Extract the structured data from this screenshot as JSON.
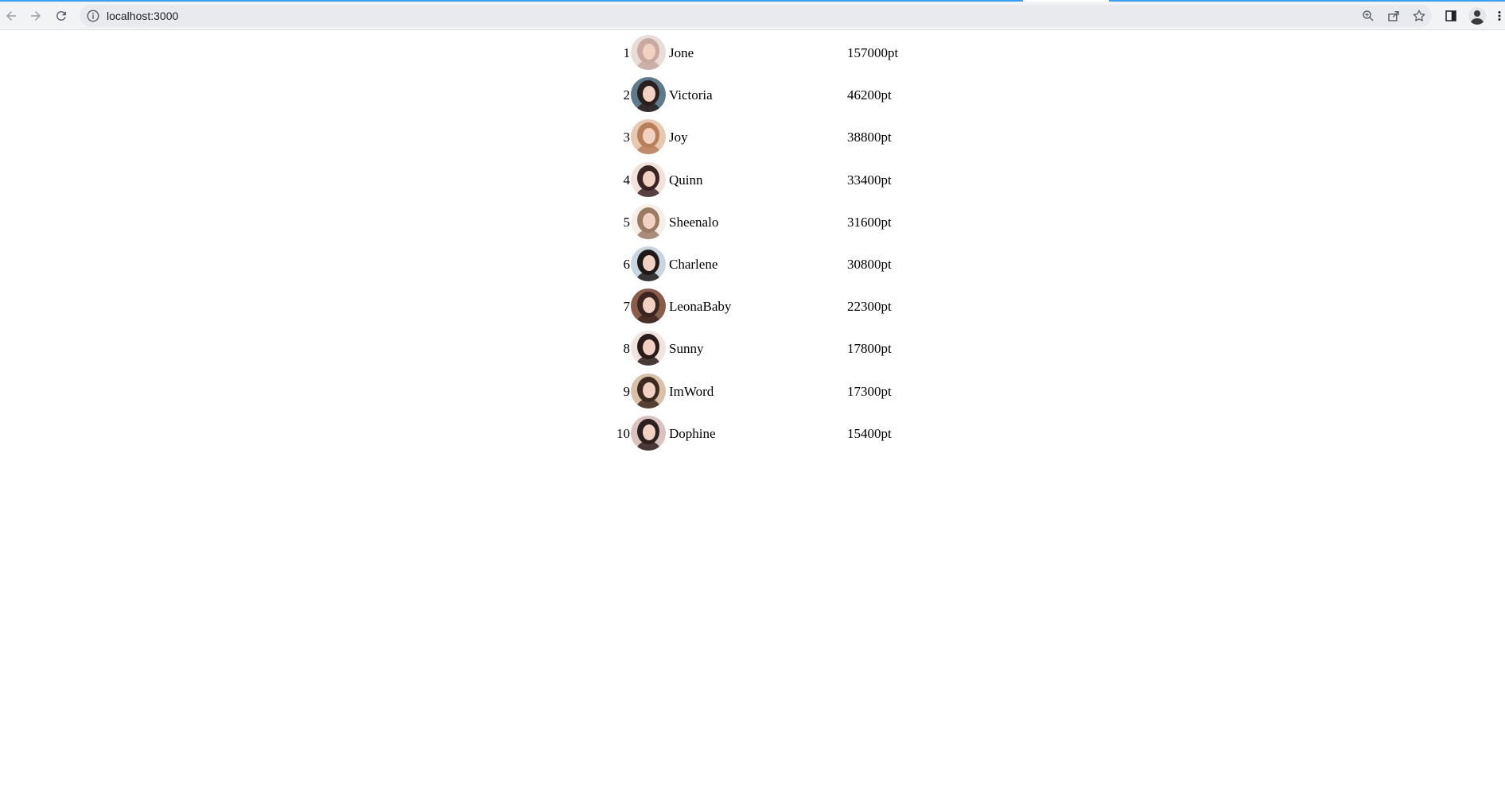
{
  "browser": {
    "url": "localhost:3000",
    "icons": {
      "back": "arrow-left-icon",
      "forward": "arrow-right-icon",
      "reload": "reload-icon",
      "info": "info-icon",
      "zoom": "zoom-icon",
      "share": "share-icon",
      "bookmark": "star-icon",
      "side_panel": "side-panel-icon",
      "profile": "profile-avatar",
      "menu": "kebab-menu-icon"
    },
    "accent": "#3aa0f3"
  },
  "ranking": [
    {
      "rank": "1",
      "name": "Jone",
      "score": "157000pt",
      "avatar_color": "#e8dcd8",
      "hair_color": "#c8a9a0"
    },
    {
      "rank": "2",
      "name": "Victoria",
      "score": "46200pt",
      "avatar_color": "#5c7a8c",
      "hair_color": "#2a1f1c"
    },
    {
      "rank": "3",
      "name": "Joy",
      "score": "38800pt",
      "avatar_color": "#e7c9b2",
      "hair_color": "#b8805a"
    },
    {
      "rank": "4",
      "name": "Quinn",
      "score": "33400pt",
      "avatar_color": "#f2e2dc",
      "hair_color": "#3a2522"
    },
    {
      "rank": "5",
      "name": "Sheenalo",
      "score": "31600pt",
      "avatar_color": "#f5efe9",
      "hair_color": "#9c7b65"
    },
    {
      "rank": "6",
      "name": "Charlene",
      "score": "30800pt",
      "avatar_color": "#c9d6e0",
      "hair_color": "#1f1a18"
    },
    {
      "rank": "7",
      "name": "LeonaBaby",
      "score": "22300pt",
      "avatar_color": "#8a5c4c",
      "hair_color": "#3b2620"
    },
    {
      "rank": "8",
      "name": "Sunny",
      "score": "17800pt",
      "avatar_color": "#efe4df",
      "hair_color": "#2b1c1a"
    },
    {
      "rank": "9",
      "name": "ImWord",
      "score": "17300pt",
      "avatar_color": "#d8c1a8",
      "hair_color": "#3e2a1f"
    },
    {
      "rank": "10",
      "name": "Dophine",
      "score": "15400pt",
      "avatar_color": "#d9c2c0",
      "hair_color": "#2e2020"
    }
  ]
}
